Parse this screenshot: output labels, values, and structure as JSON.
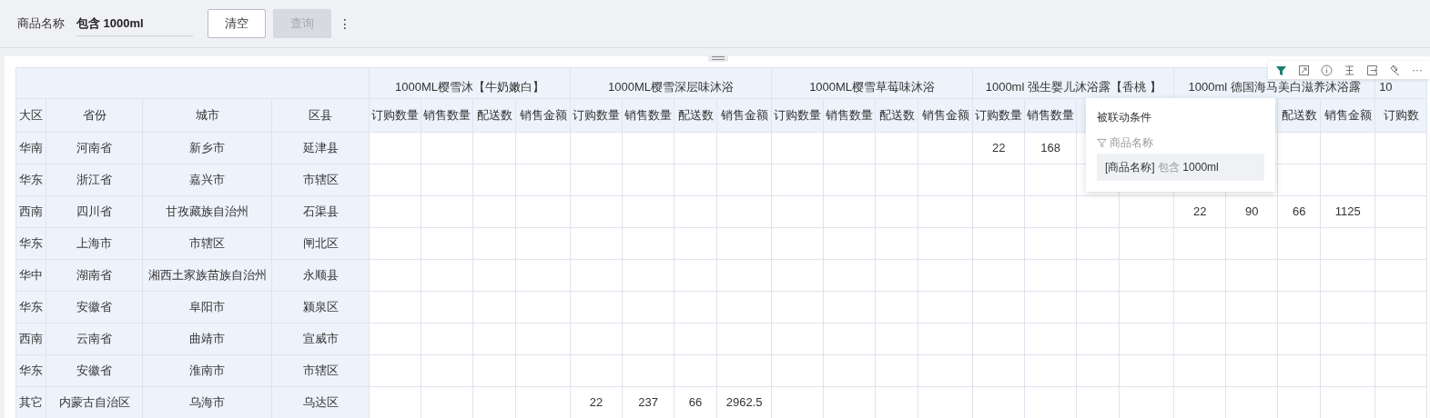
{
  "filter_bar": {
    "label": "商品名称",
    "value": "包含 1000ml",
    "buttons": [
      {
        "label": "清空",
        "disabled": false
      },
      {
        "label": "查询",
        "disabled": true
      }
    ],
    "more": "⋮"
  },
  "toolbar": {
    "icons": [
      {
        "kind": "filter",
        "active": true
      },
      {
        "kind": "expand",
        "active": false
      },
      {
        "kind": "info",
        "active": false
      },
      {
        "kind": "align",
        "active": false
      },
      {
        "kind": "export",
        "active": false
      },
      {
        "kind": "brush",
        "active": false
      }
    ],
    "more": "···"
  },
  "table": {
    "row_headers": [
      "大区",
      "省份",
      "城市",
      "区县"
    ],
    "groups": [
      {
        "title": "1000ML樱雪沐【牛奶嫩白】",
        "columns": {
          "order_qty": "订购数量",
          "sales_qty": "销售数量",
          "delivery_qty": "配送数",
          "sales_amount": "销售金额"
        }
      },
      {
        "title": "1000ML樱雪深层味沐浴",
        "columns": {
          "order_qty": "订购数量",
          "sales_qty": "销售数量",
          "delivery_qty": "配送数",
          "sales_amount": "销售金额"
        }
      },
      {
        "title": "1000ML樱雪草莓味沐浴",
        "columns": {
          "order_qty": "订购数量",
          "sales_qty": "销售数量",
          "delivery_qty": "配送数",
          "sales_amount": "销售金额"
        }
      },
      {
        "title": "1000ml 强生婴儿沐浴露【香桃 】",
        "columns": {
          "order_qty": "订购数量",
          "sales_qty": "销售数量"
        }
      },
      {
        "title": "1000ml 德国海马美白滋养沐浴露",
        "columns": {
          "delivery_qty": "配送数",
          "sales_amount": "销售金额"
        }
      },
      {
        "title": "10",
        "partial": true,
        "columns": {
          "order_qty": "订购数"
        }
      }
    ],
    "rows": [
      {
        "dims": [
          "华南",
          "河南省",
          "新乡市",
          "延津县"
        ],
        "product_4": {
          "order_qty": "22",
          "sales_qty": "168"
        }
      },
      {
        "dims": [
          "华东",
          "浙江省",
          "嘉兴市",
          "市辖区"
        ]
      },
      {
        "dims": [
          "西南",
          "四川省",
          "甘孜藏族自治州",
          "石渠县"
        ],
        "product_5": {
          "order_qty": "22",
          "sales_qty": "90",
          "delivery_qty": "66",
          "sales_amount": "1125"
        }
      },
      {
        "dims": [
          "华东",
          "上海市",
          "市辖区",
          "闸北区"
        ]
      },
      {
        "dims": [
          "华中",
          "湖南省",
          "湘西土家族苗族自治州",
          "永顺县"
        ]
      },
      {
        "dims": [
          "华东",
          "安徽省",
          "阜阳市",
          "颍泉区"
        ]
      },
      {
        "dims": [
          "西南",
          "云南省",
          "曲靖市",
          "宣威市"
        ]
      },
      {
        "dims": [
          "华东",
          "安徽省",
          "淮南市",
          "市辖区"
        ]
      },
      {
        "dims": [
          "其它",
          "内蒙古自治区",
          "乌海市",
          "乌达区"
        ],
        "product_2": {
          "order_qty": "22",
          "sales_qty": "237",
          "delivery_qty": "66",
          "sales_amount": "2962.5"
        }
      }
    ]
  },
  "popover": {
    "title": "被联动条件",
    "field": "商品名称",
    "condition_field": "[商品名称]",
    "operator": "包含",
    "condition_value": "1000ml"
  }
}
